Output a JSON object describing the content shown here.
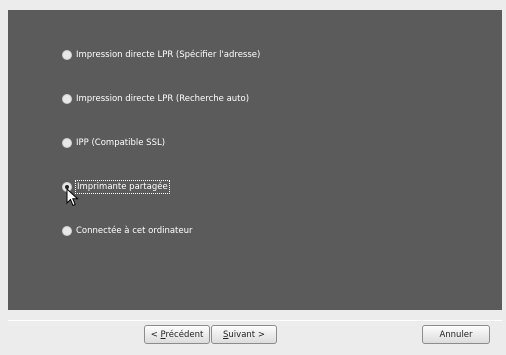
{
  "options": [
    {
      "label": "Impression directe LPR (Spécifier l'adresse)",
      "checked": false
    },
    {
      "label": "Impression directe LPR (Recherche auto)",
      "checked": false
    },
    {
      "label": "IPP (Compatible SSL)",
      "checked": false
    },
    {
      "label": "Imprimante partagée",
      "checked": true
    },
    {
      "label": "Connectée à cet ordinateur",
      "checked": false
    }
  ],
  "buttons": {
    "back": {
      "prefix": "< ",
      "mnemonic": "P",
      "rest": "récédent"
    },
    "next": {
      "prefix": "",
      "mnemonic": "S",
      "rest": "uivant >"
    },
    "cancel": {
      "label": "Annuler"
    }
  },
  "colors": {
    "panel": "#5b5b5b",
    "footer": "#ececec",
    "option_text": "#ffffff"
  }
}
